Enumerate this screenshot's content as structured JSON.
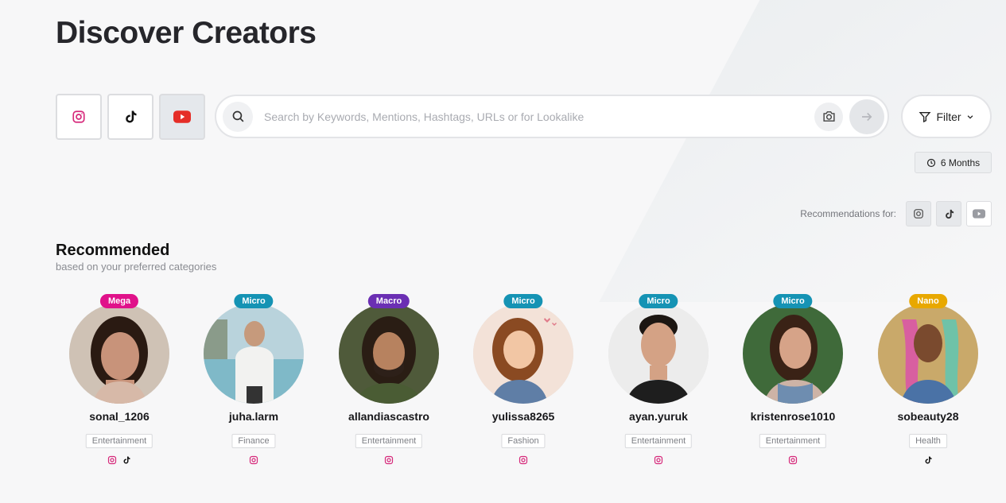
{
  "page": {
    "title": "Discover Creators"
  },
  "platforms": [
    {
      "icon": "instagram-icon",
      "active": false
    },
    {
      "icon": "tiktok-icon",
      "active": false
    },
    {
      "icon": "youtube-icon",
      "active": true
    }
  ],
  "search": {
    "placeholder": "Search by Keywords, Mentions, Hashtags, URLs or for Lookalike",
    "value": ""
  },
  "filter": {
    "label": "Filter"
  },
  "time_range": {
    "label": "6 Months"
  },
  "recommendations_for": {
    "label": "Recommendations for:"
  },
  "recommended": {
    "title": "Recommended",
    "subtitle": "based on your preferred categories"
  },
  "creators": [
    {
      "username": "sonal_1206",
      "tier": "Mega",
      "tier_color": "#e0128a",
      "category": "Entertainment",
      "socials": [
        "instagram",
        "tiktok"
      ]
    },
    {
      "username": "juha.larm",
      "tier": "Micro",
      "tier_color": "#1593b4",
      "category": "Finance",
      "socials": [
        "instagram"
      ]
    },
    {
      "username": "allandiascastro",
      "tier": "Macro",
      "tier_color": "#6b2fb3",
      "category": "Entertainment",
      "socials": [
        "instagram"
      ]
    },
    {
      "username": "yulissa8265",
      "tier": "Micro",
      "tier_color": "#1593b4",
      "category": "Fashion",
      "socials": [
        "instagram"
      ]
    },
    {
      "username": "ayan.yuruk",
      "tier": "Micro",
      "tier_color": "#1593b4",
      "category": "Entertainment",
      "socials": [
        "instagram"
      ]
    },
    {
      "username": "kristenrose1010",
      "tier": "Micro",
      "tier_color": "#1593b4",
      "category": "Entertainment",
      "socials": [
        "instagram"
      ]
    },
    {
      "username": "sobeauty28",
      "tier": "Nano",
      "tier_color": "#e8a800",
      "category": "Health",
      "socials": [
        "tiktok"
      ]
    }
  ],
  "colors": {
    "instagram": "#d6287a",
    "youtube": "#e52d27",
    "background": "#f7f7f8"
  }
}
